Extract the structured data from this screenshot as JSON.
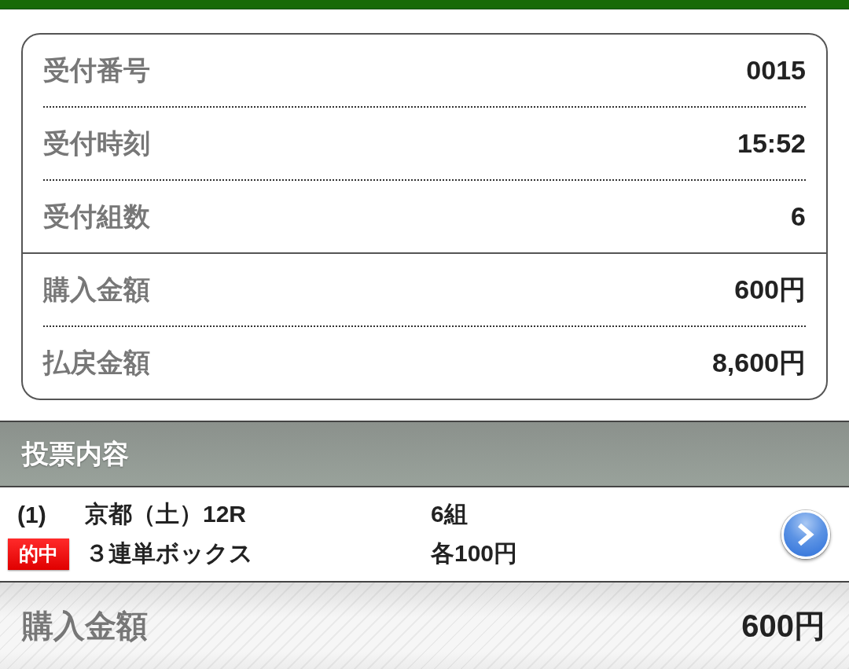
{
  "summary": {
    "groups": [
      {
        "rows": [
          {
            "label": "受付番号",
            "value": "0015"
          },
          {
            "label": "受付時刻",
            "value": "15:52"
          },
          {
            "label": "受付組数",
            "value": "6"
          }
        ]
      },
      {
        "rows": [
          {
            "label": "購入金額",
            "value": "600円"
          },
          {
            "label": "払戻金額",
            "value": "8,600円"
          }
        ]
      }
    ]
  },
  "section": {
    "title": "投票内容"
  },
  "bets": [
    {
      "number": "(1)",
      "race": "京都（土）12R",
      "combinations": "6組",
      "badge": "的中",
      "bet_type": "３連単ボックス",
      "stake": "各100円"
    }
  ],
  "total": {
    "label": "購入金額",
    "value": "600円"
  }
}
